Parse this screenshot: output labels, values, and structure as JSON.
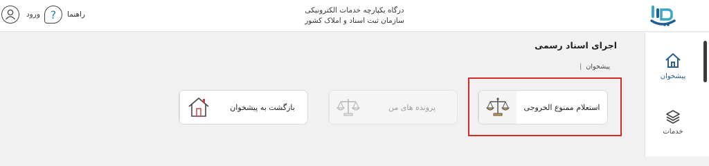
{
  "header": {
    "line1": "درگاه یکپارچه خدمات الکترونیکی",
    "line2": "سازمان ثبت اسناد و املاک کشور",
    "guide_label": "راهنما",
    "guide_glyph": "?",
    "login_label": "ورود",
    "logo_icon": "sabt-logo"
  },
  "sidebar": {
    "items": [
      {
        "label": "پیشخوان",
        "icon": "home-icon"
      },
      {
        "label": "خدمات",
        "icon": "layers-icon"
      }
    ]
  },
  "page": {
    "title": "اجرای اسناد رسمی",
    "breadcrumb": "پیشخوان"
  },
  "cards": [
    {
      "label": "استعلام ممنوع الخروجی",
      "icon": "scales-icon",
      "enabled": true,
      "highlighted": true
    },
    {
      "label": "پرونده های من",
      "icon": "scales-icon",
      "enabled": false
    },
    {
      "label": "بازگشت به پیشخوان",
      "icon": "house-icon",
      "enabled": true
    }
  ],
  "colors": {
    "accent": "#2a5f8c",
    "highlight": "#d32a2a",
    "logo_blue": "#1f5f96",
    "logo_teal": "#3aa7c9",
    "scales_gold": "#c9a03a",
    "house_red": "#c43c3c"
  }
}
